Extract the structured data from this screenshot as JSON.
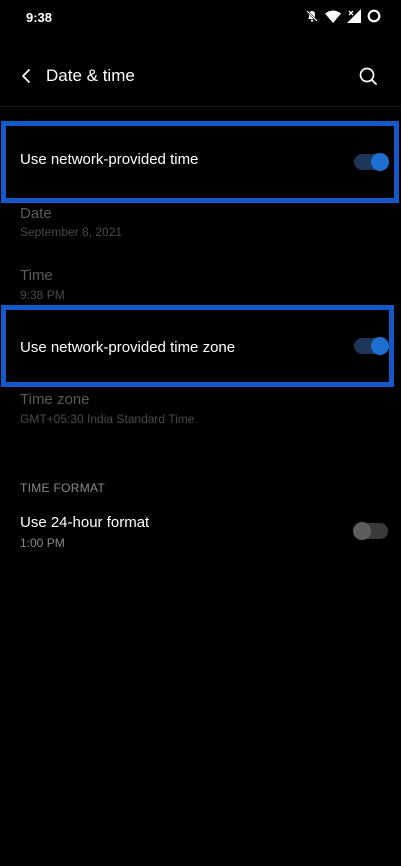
{
  "status_bar": {
    "time": "9:38",
    "icons": [
      "mute-icon",
      "wifi-icon",
      "signal-icon",
      "battery-icon"
    ]
  },
  "app_bar": {
    "title": "Date & time"
  },
  "settings": {
    "network_time": {
      "title": "Use network-provided time",
      "enabled": true
    },
    "date": {
      "title": "Date",
      "value": "September 8, 2021"
    },
    "time": {
      "title": "Time",
      "value": "9:38 PM"
    },
    "network_time_zone": {
      "title": "Use network-provided time zone",
      "enabled": true
    },
    "time_zone": {
      "title": "Time zone",
      "value": "GMT+05:30 India Standard Time"
    }
  },
  "time_format": {
    "header": "TIME FORMAT",
    "use_24_hour": {
      "title": "Use 24-hour format",
      "example": "1:00 PM",
      "enabled": false
    }
  },
  "colors": {
    "accent": "#1f6fd1",
    "highlight": "#1558c9",
    "background": "#000000"
  }
}
